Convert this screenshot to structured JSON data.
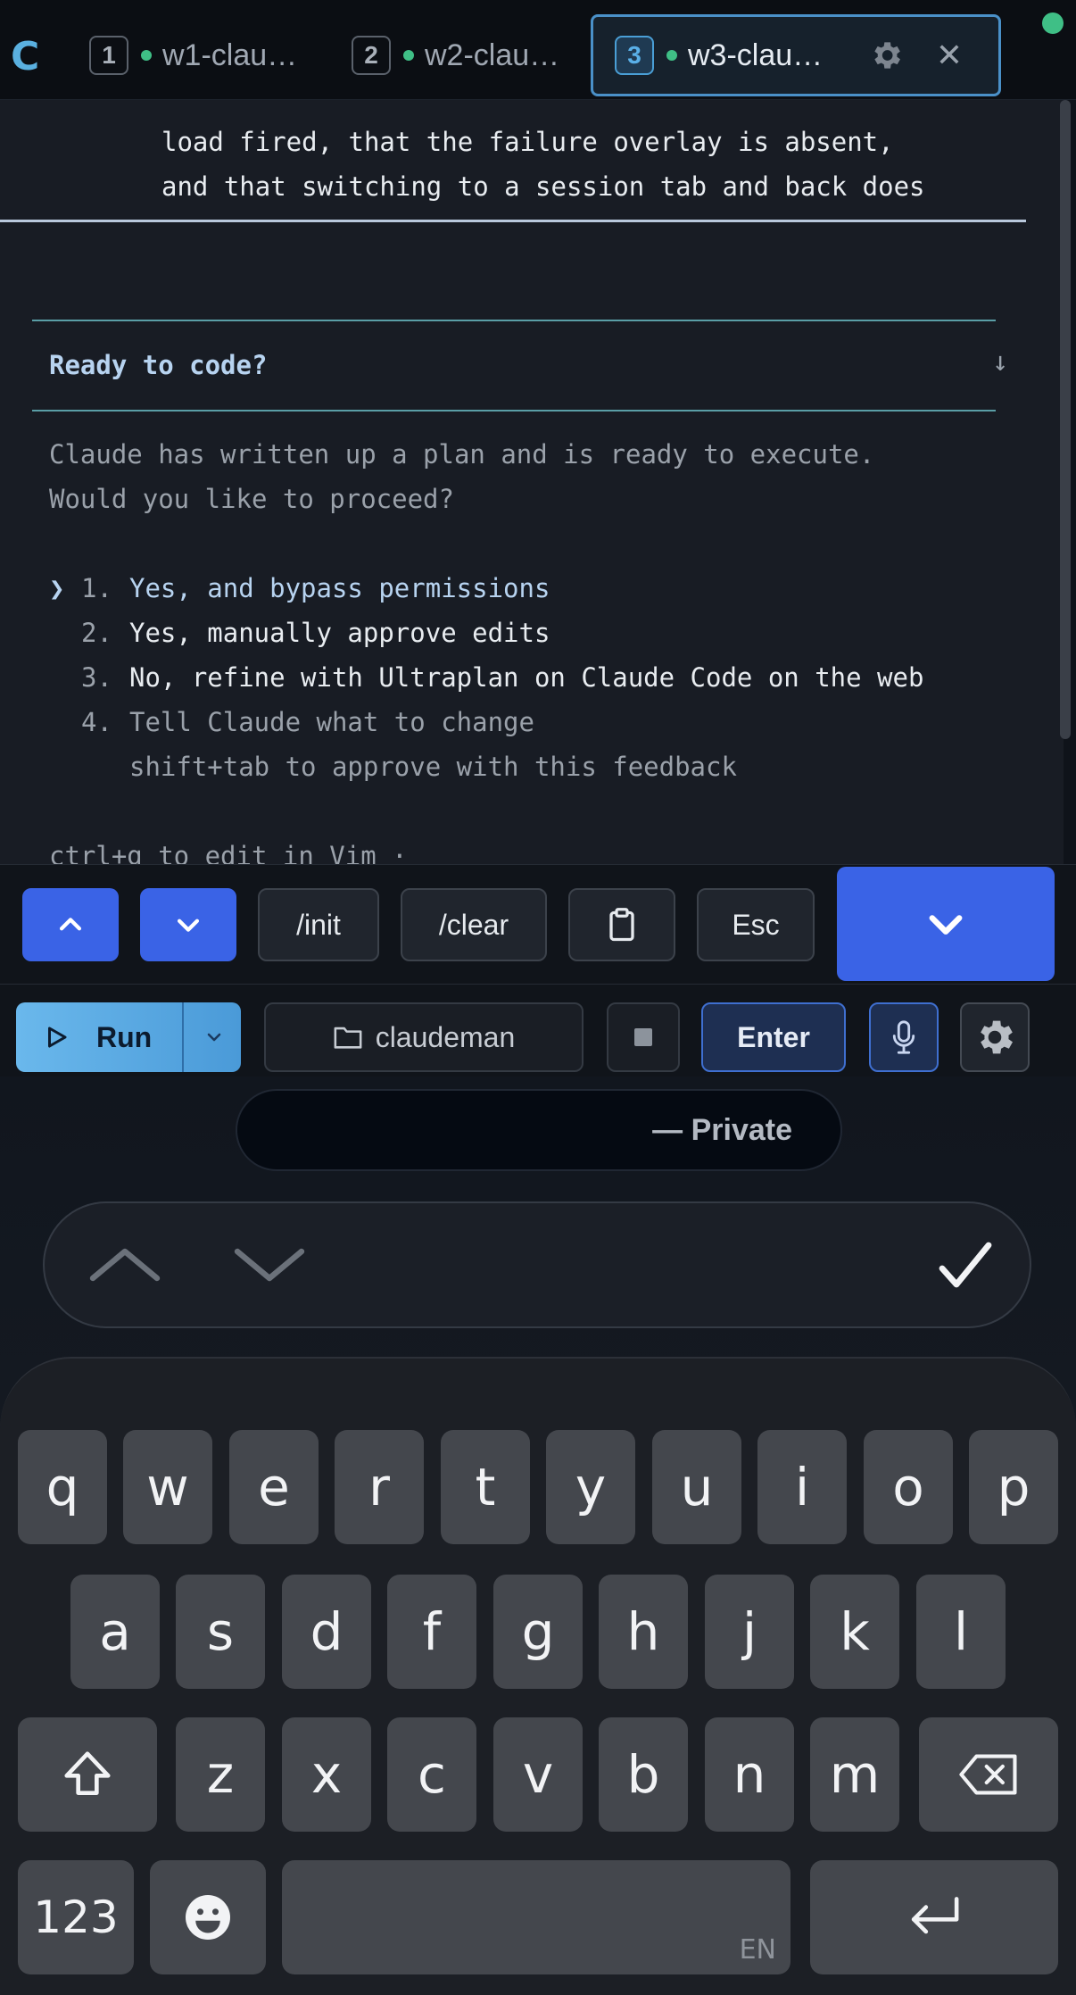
{
  "app": {
    "letter": "C"
  },
  "tabs": [
    {
      "num": "1",
      "label": "w1-clau…"
    },
    {
      "num": "2",
      "label": "w2-clau…"
    },
    {
      "num": "3",
      "label": "w3-clau…"
    }
  ],
  "terminal": {
    "lines_top": [
      "load fired, that the failure overlay is absent,",
      "and that switching to a session tab and back does"
    ],
    "prompt_title": "Ready to code?",
    "description": [
      "Claude has written up a plan and is ready to execute.",
      "Would you like to proceed?"
    ],
    "caret": "❯",
    "options": [
      {
        "num": "1.",
        "text": "Yes, and bypass permissions"
      },
      {
        "num": "2.",
        "text": "Yes, manually approve edits"
      },
      {
        "num": "3.",
        "text": "No, refine with Ultraplan on Claude Code on the web"
      },
      {
        "num": "4.",
        "text": "Tell Claude what to change"
      }
    ],
    "option_hint": "shift+tab to approve with this feedback",
    "footer": "ctrl+g to edit in Vim ·"
  },
  "actions": {
    "init": "/init",
    "clear": "/clear",
    "esc": "Esc"
  },
  "runbar": {
    "run": "Run",
    "folder": "claudeman",
    "enter": "Enter"
  },
  "browser": {
    "private": "— Private"
  },
  "keyboard": {
    "row1": [
      "q",
      "w",
      "e",
      "r",
      "t",
      "y",
      "u",
      "i",
      "o",
      "p"
    ],
    "row2": [
      "a",
      "s",
      "d",
      "f",
      "g",
      "h",
      "j",
      "k",
      "l"
    ],
    "row3": [
      "z",
      "x",
      "c",
      "v",
      "b",
      "n",
      "m"
    ],
    "numbers": "123",
    "lang": "EN"
  }
}
